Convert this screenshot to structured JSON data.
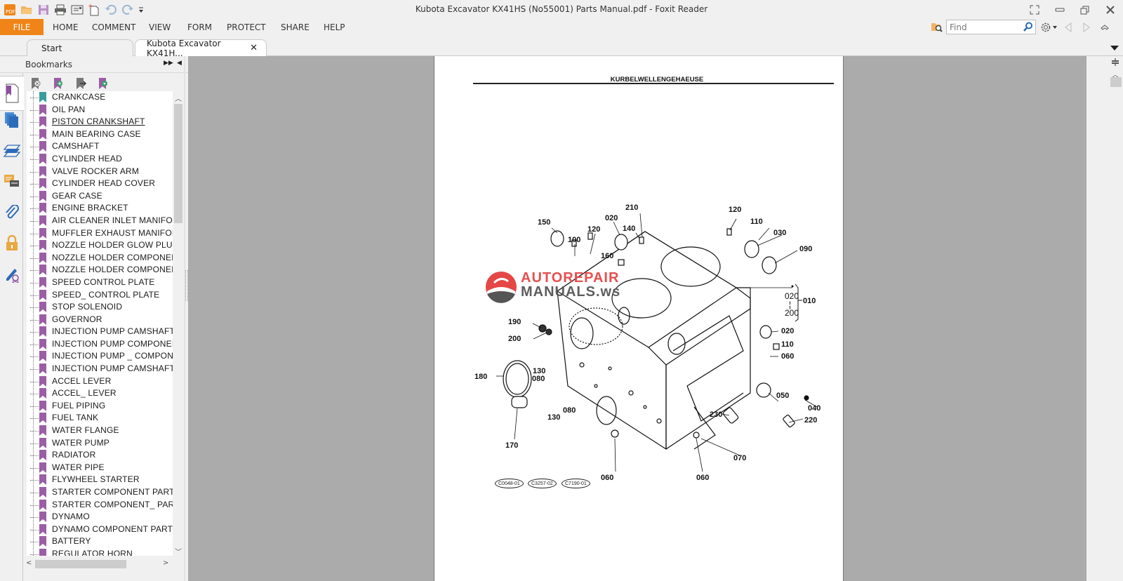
{
  "window": {
    "title": "Kubota Excavator KX41HS (No55001) Parts Manual.pdf - Foxit Reader"
  },
  "quick_access": [
    "app-logo-icon",
    "open-icon",
    "save-icon",
    "print-icon",
    "email-icon",
    "new-icon",
    "undo-icon",
    "redo-icon",
    "customize-icon"
  ],
  "menu": {
    "file": "FILE",
    "items": [
      "HOME",
      "COMMENT",
      "VIEW",
      "FORM",
      "PROTECT",
      "SHARE",
      "HELP"
    ]
  },
  "search": {
    "placeholder": "Find",
    "value": ""
  },
  "tabs": [
    {
      "label": "Start",
      "active": false
    },
    {
      "label": "Kubota Excavator KX41H...",
      "active": true
    }
  ],
  "bookmarks_panel": {
    "title": "Bookmarks",
    "items": [
      {
        "label": "CRANKCASE",
        "color": "#3a9e9e"
      },
      {
        "label": "OIL PAN"
      },
      {
        "label": "PISTON  CRANKSHAFT",
        "underlined": true
      },
      {
        "label": "MAIN BEARING CASE"
      },
      {
        "label": "CAMSHAFT"
      },
      {
        "label": "CYLINDER HEAD"
      },
      {
        "label": "VALVE  ROCKER ARM"
      },
      {
        "label": "CYLINDER HEAD COVER"
      },
      {
        "label": "GEAR CASE"
      },
      {
        "label": "ENGINE BRACKET"
      },
      {
        "label": "AIR CLEANER  INLET MANIFOLD"
      },
      {
        "label": "MUFFLER  EXHAUST MANIFOLD"
      },
      {
        "label": "NOZZLE HOLDER  GLOW PLUG"
      },
      {
        "label": "NOZZLE HOLDER  COMPONENT"
      },
      {
        "label": "NOZZLE HOLDER  COMPONENT"
      },
      {
        "label": "SPEED CONTROL PLATE"
      },
      {
        "label": "SPEED_ CONTROL PLATE"
      },
      {
        "label": "STOP SOLENOID"
      },
      {
        "label": "GOVERNOR"
      },
      {
        "label": "INJECTION PUMP  CAMSHAFT"
      },
      {
        "label": "INJECTION PUMP  COMPONENT"
      },
      {
        "label": "INJECTION PUMP _ COMPONEN"
      },
      {
        "label": "INJECTION PUMP  CAMSHAFT"
      },
      {
        "label": "ACCEL LEVER"
      },
      {
        "label": "ACCEL_ LEVER"
      },
      {
        "label": "FUEL PIPING"
      },
      {
        "label": "FUEL TANK"
      },
      {
        "label": "WATER FLANGE"
      },
      {
        "label": "WATER PUMP"
      },
      {
        "label": "RADIATOR"
      },
      {
        "label": "WATER PIPE"
      },
      {
        "label": "FLYWHEEL STARTER"
      },
      {
        "label": "STARTER  COMPONENT PARTS"
      },
      {
        "label": "STARTER  COMPONENT_ PART"
      },
      {
        "label": "DYNAMO"
      },
      {
        "label": "DYNAMO  COMPONENT PARTS"
      },
      {
        "label": "BATTERY"
      },
      {
        "label": "REGULATOR  HORN"
      }
    ],
    "default_flag_color": "#9b5ea6"
  },
  "left_nav": [
    "bookmarks-icon",
    "pages-icon",
    "layers-icon",
    "comments-icon",
    "attachments-icon",
    "security-icon",
    "signature-icon"
  ],
  "document": {
    "page_heading": "KURBELWELLENGEHAEUSE",
    "watermark": {
      "line1": "AUTOREPAIR",
      "line2": "MANUALS.ws"
    },
    "callouts": [
      "210",
      "150",
      "100",
      "120",
      "020",
      "140",
      "120",
      "110",
      "030",
      "090",
      "160",
      "010",
      "190",
      "200",
      "180",
      "130",
      "080",
      "130",
      "080",
      "170",
      "020",
      "110",
      "060",
      "050",
      "040",
      "230",
      "220",
      "070",
      "060",
      "060"
    ],
    "group_range": {
      "from": "020",
      "to": "200",
      "group": "010"
    },
    "reference_codes": [
      "C0048-01",
      "C3257-02",
      "C7190-01"
    ]
  }
}
